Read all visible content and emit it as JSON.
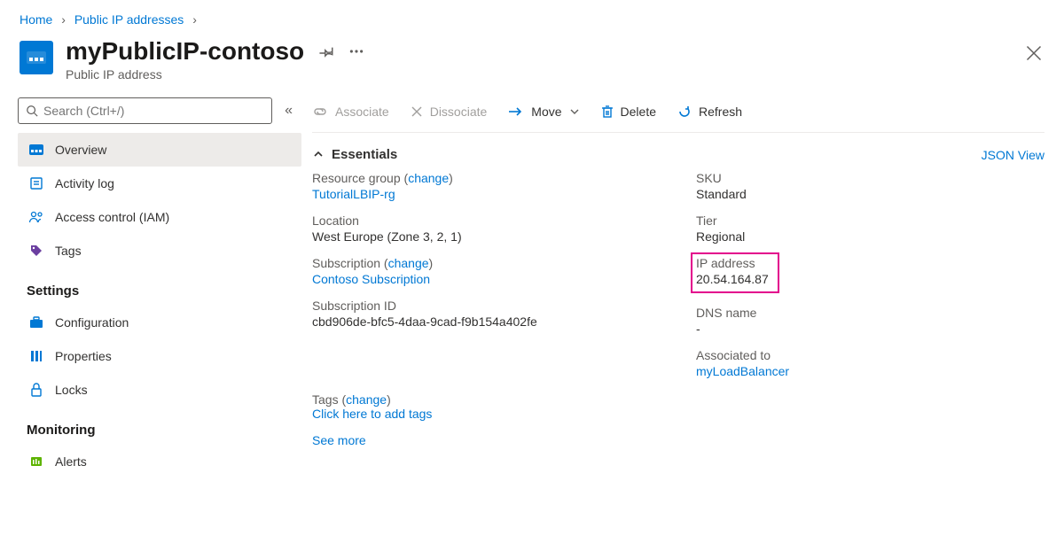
{
  "breadcrumb": {
    "home": "Home",
    "parent": "Public IP addresses"
  },
  "header": {
    "title": "myPublicIP-contoso",
    "subtitle": "Public IP address"
  },
  "search": {
    "placeholder": "Search (Ctrl+/)"
  },
  "nav": {
    "overview": "Overview",
    "activity": "Activity log",
    "iam": "Access control (IAM)",
    "tags": "Tags",
    "settings": "Settings",
    "configuration": "Configuration",
    "properties": "Properties",
    "locks": "Locks",
    "monitoring": "Monitoring",
    "alerts": "Alerts"
  },
  "toolbar": {
    "associate": "Associate",
    "dissociate": "Dissociate",
    "move": "Move",
    "delete": "Delete",
    "refresh": "Refresh"
  },
  "essentials": {
    "toggle": "Essentials",
    "jsonview": "JSON View",
    "left": {
      "rg_label": "Resource group",
      "change": "change",
      "rg_value": "TutorialLBIP-rg",
      "loc_label": "Location",
      "loc_value": "West Europe (Zone 3, 2, 1)",
      "sub_label": "Subscription",
      "sub_value": "Contoso Subscription",
      "subid_label": "Subscription ID",
      "subid_value": "cbd906de-bfc5-4daa-9cad-f9b154a402fe"
    },
    "right": {
      "sku_label": "SKU",
      "sku_value": "Standard",
      "tier_label": "Tier",
      "tier_value": "Regional",
      "ip_label": "IP address",
      "ip_value": "20.54.164.87",
      "dns_label": "DNS name",
      "dns_value": "-",
      "assoc_label": "Associated to",
      "assoc_value": "myLoadBalancer"
    },
    "tags_label": "Tags",
    "tags_link": "Click here to add tags",
    "seemore": "See more"
  }
}
